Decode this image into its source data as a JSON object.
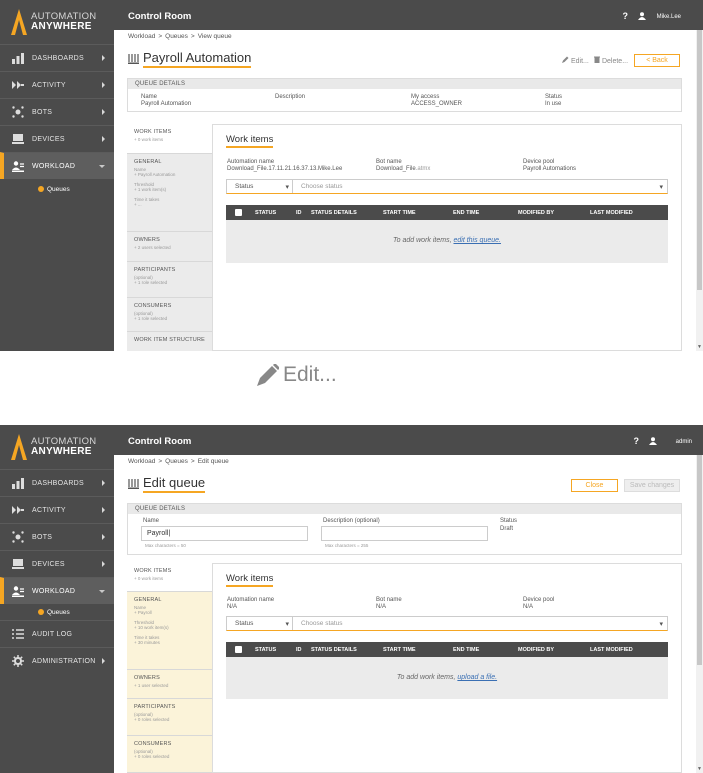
{
  "logo": {
    "line1": "AUTOMATION",
    "line2": "ANYWHERE"
  },
  "nav": {
    "dashboards": "DASHBOARDS",
    "activity": "ACTIVITY",
    "bots": "BOTS",
    "devices": "DEVICES",
    "workload": "WORKLOAD",
    "queues": "Queues",
    "audit_log": "AUDIT LOG",
    "administration": "ADMINISTRATION"
  },
  "view": {
    "app_title": "Control Room",
    "help": "?",
    "user": "Mike.Lee",
    "breadcrumb": [
      "Workload",
      ">",
      "Queues",
      ">",
      "View queue"
    ],
    "title": "Payroll Automation",
    "edit_label": "Edit...",
    "delete_label": "Delete...",
    "back_label": "< Back",
    "queue_details_header": "QUEUE DETAILS",
    "name_label": "Name",
    "name_value": "Payroll Automation",
    "description_label": "Description",
    "my_access_label": "My access",
    "my_access_value": "ACCESS_OWNER",
    "status_label": "Status",
    "status_value": "In use",
    "left_sections": [
      {
        "title": "WORK ITEMS",
        "sub": "+ 0 work items"
      },
      {
        "title": "GENERAL",
        "sub": "Name\n+ Payroll Automation\n\nThreshold\n+ 1 work item(s)\n\nTime it takes\n+ ..."
      },
      {
        "title": "OWNERS",
        "sub": "+ 2 users selected"
      },
      {
        "title": "PARTICIPANTS",
        "sub": "(optional)\n+ 1 role selected"
      },
      {
        "title": "CONSUMERS",
        "sub": "(optional)\n+ 1 role selected"
      },
      {
        "title": "WORK ITEM STRUCTURE",
        "sub": ""
      }
    ],
    "work_items_title": "Work items",
    "automation_name_label": "Automation name",
    "automation_name_value": "Download_File.17.11.21.16.37.13.Mike.Lee",
    "bot_name_label": "Bot name",
    "bot_name_value": "Download_File",
    "bot_name_ext": ".atmx",
    "device_pool_label": "Device pool",
    "device_pool_value": "Payroll Automations",
    "filter_status": "Status",
    "filter_placeholder": "Choose status",
    "grid_headers": [
      "STATUS",
      "ID",
      "STATUS DETAILS",
      "START TIME",
      "END TIME",
      "MODIFIED BY",
      "LAST MODIFIED"
    ],
    "empty_text": "To add work items,",
    "empty_link": "edit this queue."
  },
  "zoom_label": "Edit...",
  "edit": {
    "app_title": "Control Room",
    "help": "?",
    "user": "admin",
    "breadcrumb": [
      "Workload",
      ">",
      "Queues",
      ">",
      "Edit queue"
    ],
    "title": "Edit queue",
    "close_label": "Close",
    "save_label": "Save changes",
    "queue_details_header": "QUEUE DETAILS",
    "name_label": "Name",
    "name_value": "Payroll|",
    "name_hint": "Max characters = 50",
    "description_label": "Description (optional)",
    "description_value": "",
    "description_hint": "Max characters = 255",
    "status_label": "Status",
    "status_value": "Draft",
    "left_sections": [
      {
        "title": "WORK ITEMS",
        "sub": "+ 0 work items"
      },
      {
        "title": "GENERAL",
        "sub": "Name\n+ Payroll\n\nThreshold\n+ 10 work item(s)\n\nTime it takes\n+ 30 minutes"
      },
      {
        "title": "OWNERS",
        "sub": "+ 1 user selected"
      },
      {
        "title": "PARTICIPANTS",
        "sub": "(optional)\n+ 0 roles selected"
      },
      {
        "title": "CONSUMERS",
        "sub": "(optional)\n+ 0 roles selected"
      }
    ],
    "work_items_title": "Work items",
    "automation_name_label": "Automation name",
    "automation_name_value": "N/A",
    "bot_name_label": "Bot name",
    "bot_name_value": "N/A",
    "device_pool_label": "Device pool",
    "device_pool_value": "N/A",
    "filter_status": "Status",
    "filter_placeholder": "Choose status",
    "grid_headers": [
      "STATUS",
      "ID",
      "STATUS DETAILS",
      "START TIME",
      "END TIME",
      "MODIFIED BY",
      "LAST MODIFIED"
    ],
    "empty_text": "To add work items,",
    "empty_link": "upload a file."
  },
  "colors": {
    "accent": "#f5a623",
    "sidebar": "#4b4b4b",
    "grid_header": "#4b4b4b",
    "link": "#3a6fb3"
  },
  "icons": [
    "logo-chevron-icon",
    "dashboards-icon",
    "activity-icon",
    "bots-icon",
    "devices-icon",
    "workload-icon",
    "audit-log-icon",
    "administration-icon",
    "help-icon",
    "user-icon",
    "queue-icon",
    "pencil-icon",
    "trash-icon"
  ]
}
